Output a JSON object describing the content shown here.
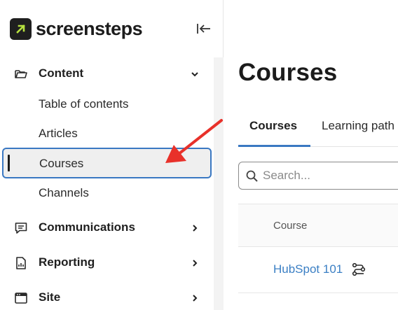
{
  "app": {
    "logo_text": "screensteps"
  },
  "sidebar": {
    "content_section": {
      "label": "Content",
      "icon": "folder-icon"
    },
    "content_items": [
      {
        "label": "Table of contents"
      },
      {
        "label": "Articles"
      },
      {
        "label": "Courses",
        "active": true
      },
      {
        "label": "Channels"
      }
    ],
    "sections": [
      {
        "label": "Communications",
        "icon": "chat-icon"
      },
      {
        "label": "Reporting",
        "icon": "report-icon"
      },
      {
        "label": "Site",
        "icon": "browser-window-icon"
      }
    ]
  },
  "main": {
    "page_title": "Courses",
    "tabs": [
      {
        "label": "Courses",
        "active": true
      },
      {
        "label": "Learning path"
      }
    ],
    "search": {
      "placeholder": "Search..."
    },
    "table": {
      "columns": [
        "Course"
      ],
      "rows": [
        {
          "course": "HubSpot 101",
          "icon": "learning-path-icon"
        }
      ]
    }
  },
  "colors": {
    "accent": "#3a78c2",
    "link": "#3b7fc4",
    "annotation_arrow": "#e8312a",
    "logo_arrow": "#b6e13f"
  }
}
